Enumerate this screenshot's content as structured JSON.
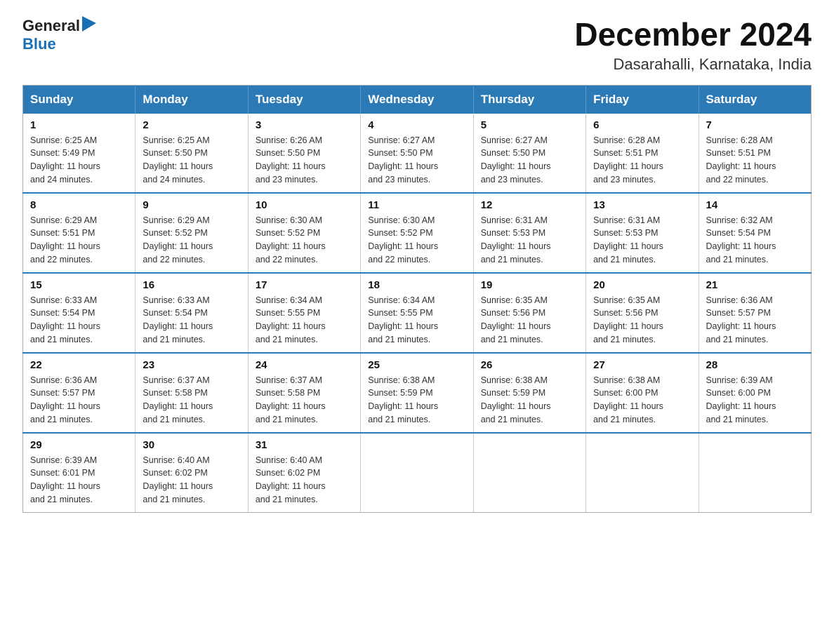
{
  "header": {
    "logo_general": "General",
    "logo_blue": "Blue",
    "month_title": "December 2024",
    "location": "Dasarahalli, Karnataka, India"
  },
  "weekdays": [
    "Sunday",
    "Monday",
    "Tuesday",
    "Wednesday",
    "Thursday",
    "Friday",
    "Saturday"
  ],
  "weeks": [
    [
      {
        "day": "1",
        "sunrise": "6:25 AM",
        "sunset": "5:49 PM",
        "daylight": "11 hours and 24 minutes."
      },
      {
        "day": "2",
        "sunrise": "6:25 AM",
        "sunset": "5:50 PM",
        "daylight": "11 hours and 24 minutes."
      },
      {
        "day": "3",
        "sunrise": "6:26 AM",
        "sunset": "5:50 PM",
        "daylight": "11 hours and 23 minutes."
      },
      {
        "day": "4",
        "sunrise": "6:27 AM",
        "sunset": "5:50 PM",
        "daylight": "11 hours and 23 minutes."
      },
      {
        "day": "5",
        "sunrise": "6:27 AM",
        "sunset": "5:50 PM",
        "daylight": "11 hours and 23 minutes."
      },
      {
        "day": "6",
        "sunrise": "6:28 AM",
        "sunset": "5:51 PM",
        "daylight": "11 hours and 23 minutes."
      },
      {
        "day": "7",
        "sunrise": "6:28 AM",
        "sunset": "5:51 PM",
        "daylight": "11 hours and 22 minutes."
      }
    ],
    [
      {
        "day": "8",
        "sunrise": "6:29 AM",
        "sunset": "5:51 PM",
        "daylight": "11 hours and 22 minutes."
      },
      {
        "day": "9",
        "sunrise": "6:29 AM",
        "sunset": "5:52 PM",
        "daylight": "11 hours and 22 minutes."
      },
      {
        "day": "10",
        "sunrise": "6:30 AM",
        "sunset": "5:52 PM",
        "daylight": "11 hours and 22 minutes."
      },
      {
        "day": "11",
        "sunrise": "6:30 AM",
        "sunset": "5:52 PM",
        "daylight": "11 hours and 22 minutes."
      },
      {
        "day": "12",
        "sunrise": "6:31 AM",
        "sunset": "5:53 PM",
        "daylight": "11 hours and 21 minutes."
      },
      {
        "day": "13",
        "sunrise": "6:31 AM",
        "sunset": "5:53 PM",
        "daylight": "11 hours and 21 minutes."
      },
      {
        "day": "14",
        "sunrise": "6:32 AM",
        "sunset": "5:54 PM",
        "daylight": "11 hours and 21 minutes."
      }
    ],
    [
      {
        "day": "15",
        "sunrise": "6:33 AM",
        "sunset": "5:54 PM",
        "daylight": "11 hours and 21 minutes."
      },
      {
        "day": "16",
        "sunrise": "6:33 AM",
        "sunset": "5:54 PM",
        "daylight": "11 hours and 21 minutes."
      },
      {
        "day": "17",
        "sunrise": "6:34 AM",
        "sunset": "5:55 PM",
        "daylight": "11 hours and 21 minutes."
      },
      {
        "day": "18",
        "sunrise": "6:34 AM",
        "sunset": "5:55 PM",
        "daylight": "11 hours and 21 minutes."
      },
      {
        "day": "19",
        "sunrise": "6:35 AM",
        "sunset": "5:56 PM",
        "daylight": "11 hours and 21 minutes."
      },
      {
        "day": "20",
        "sunrise": "6:35 AM",
        "sunset": "5:56 PM",
        "daylight": "11 hours and 21 minutes."
      },
      {
        "day": "21",
        "sunrise": "6:36 AM",
        "sunset": "5:57 PM",
        "daylight": "11 hours and 21 minutes."
      }
    ],
    [
      {
        "day": "22",
        "sunrise": "6:36 AM",
        "sunset": "5:57 PM",
        "daylight": "11 hours and 21 minutes."
      },
      {
        "day": "23",
        "sunrise": "6:37 AM",
        "sunset": "5:58 PM",
        "daylight": "11 hours and 21 minutes."
      },
      {
        "day": "24",
        "sunrise": "6:37 AM",
        "sunset": "5:58 PM",
        "daylight": "11 hours and 21 minutes."
      },
      {
        "day": "25",
        "sunrise": "6:38 AM",
        "sunset": "5:59 PM",
        "daylight": "11 hours and 21 minutes."
      },
      {
        "day": "26",
        "sunrise": "6:38 AM",
        "sunset": "5:59 PM",
        "daylight": "11 hours and 21 minutes."
      },
      {
        "day": "27",
        "sunrise": "6:38 AM",
        "sunset": "6:00 PM",
        "daylight": "11 hours and 21 minutes."
      },
      {
        "day": "28",
        "sunrise": "6:39 AM",
        "sunset": "6:00 PM",
        "daylight": "11 hours and 21 minutes."
      }
    ],
    [
      {
        "day": "29",
        "sunrise": "6:39 AM",
        "sunset": "6:01 PM",
        "daylight": "11 hours and 21 minutes."
      },
      {
        "day": "30",
        "sunrise": "6:40 AM",
        "sunset": "6:02 PM",
        "daylight": "11 hours and 21 minutes."
      },
      {
        "day": "31",
        "sunrise": "6:40 AM",
        "sunset": "6:02 PM",
        "daylight": "11 hours and 21 minutes."
      },
      null,
      null,
      null,
      null
    ]
  ],
  "labels": {
    "sunrise": "Sunrise:",
    "sunset": "Sunset:",
    "daylight": "Daylight:"
  }
}
